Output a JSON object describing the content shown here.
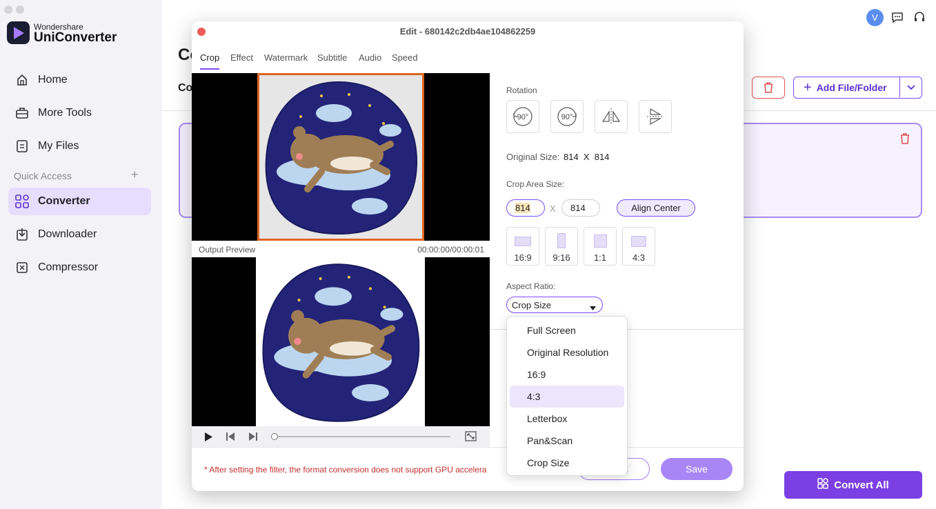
{
  "app": {
    "brand_small": "Wondershare",
    "brand_large": "UniConverter"
  },
  "sidebar": {
    "items": [
      {
        "label": "Home",
        "icon": "home-icon"
      },
      {
        "label": "More Tools",
        "icon": "toolbox-icon"
      },
      {
        "label": "My Files",
        "icon": "file-icon"
      }
    ],
    "quick_access_label": "Quick Access",
    "quick_items": [
      {
        "label": "Converter",
        "icon": "converter-icon",
        "active": true
      },
      {
        "label": "Downloader",
        "icon": "download-icon"
      },
      {
        "label": "Compressor",
        "icon": "compress-icon"
      }
    ]
  },
  "header": {
    "avatar_letter": "V",
    "bg_title": "Co",
    "bg_subtitle": "Co",
    "add_file_label": "Add File/Folder"
  },
  "bottom": {
    "convert_all_label": "Convert All"
  },
  "dialog": {
    "title": "Edit - 680142c2db4ae104862259",
    "tabs": [
      "Crop",
      "Effect",
      "Watermark",
      "Subtitle",
      "Audio",
      "Speed"
    ],
    "active_tab": "Crop",
    "output_preview_label": "Output Preview",
    "timecode": "00:00:00/00:00:01",
    "rotation_label": "Rotation",
    "rotation_buttons": [
      "90°",
      "90°"
    ],
    "original_size_label": "Original Size:",
    "original_size_value": "814  X  814",
    "crop_area_label": "Crop Area Size:",
    "crop_width": "814",
    "crop_x": "X",
    "crop_height": "814",
    "align_center_label": "Align Center",
    "aspect_buttons": [
      "16:9",
      "9:16",
      "1:1",
      "4:3"
    ],
    "aspect_ratio_label": "Aspect Ratio:",
    "aspect_ratio_value": "Crop Size",
    "warning": "* After setting the filter, the format conversion does not support GPU accelera",
    "cancel_label": "l",
    "save_label": "Save"
  },
  "dropdown": {
    "options": [
      "Full Screen",
      "Original Resolution",
      "16:9",
      "4:3",
      "Letterbox",
      "Pan&Scan",
      "Crop Size"
    ],
    "highlighted": "4:3"
  },
  "colors": {
    "accent": "#7b4bff",
    "crop_border": "#e0641e",
    "convert_all": "#7b3fe4",
    "warning": "#c43030"
  }
}
